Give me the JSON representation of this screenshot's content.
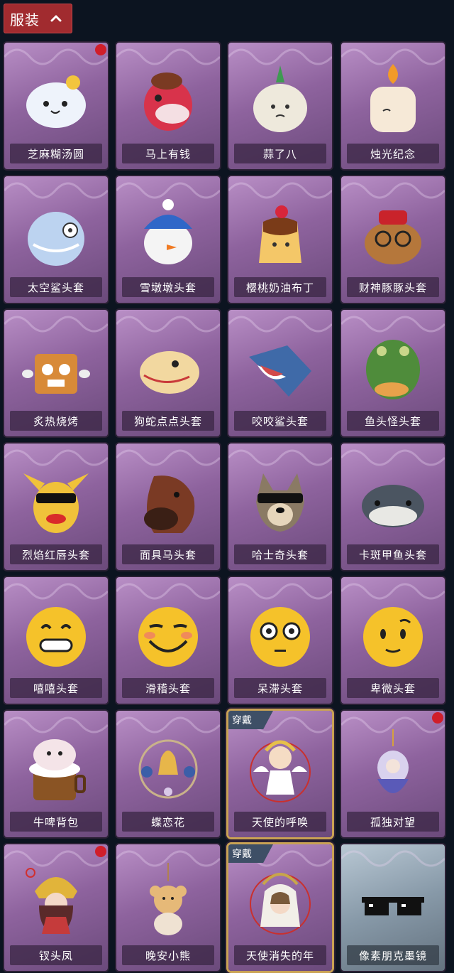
{
  "category": {
    "label": "服装",
    "toggle_icon": "chevron-up-icon"
  },
  "colors": {
    "accent": "#a12b2f",
    "notification": "#d01e2a",
    "worn_border": "#c9a254"
  },
  "items": [
    {
      "name": "芝麻糊汤圆",
      "icon": "dumpling-icon",
      "new": true
    },
    {
      "name": "马上有钱",
      "icon": "horse-head-icon",
      "new": false
    },
    {
      "name": "蒜了八",
      "icon": "garlic-icon",
      "new": false
    },
    {
      "name": "烛光纪念",
      "icon": "candle-icon",
      "new": false
    },
    {
      "name": "太空鲨头套",
      "icon": "shark-icon",
      "new": false
    },
    {
      "name": "雪墩墩头套",
      "icon": "snowman-icon",
      "new": false
    },
    {
      "name": "樱桃奶油布丁",
      "icon": "pudding-icon",
      "new": false
    },
    {
      "name": "财神豚豚头套",
      "icon": "capybara-icon",
      "new": false
    },
    {
      "name": "炙热烧烤",
      "icon": "bbq-icon",
      "new": false
    },
    {
      "name": "狗蛇点点头套",
      "icon": "snake-icon",
      "new": false
    },
    {
      "name": "咬咬鲨头套",
      "icon": "shark-bite-icon",
      "new": false
    },
    {
      "name": "鱼头怪头套",
      "icon": "fish-head-icon",
      "new": false
    },
    {
      "name": "烈焰红唇头套",
      "icon": "pikachu-icon",
      "new": false
    },
    {
      "name": "面具马头套",
      "icon": "horse-mask-icon",
      "new": false
    },
    {
      "name": "哈士奇头套",
      "icon": "husky-icon",
      "new": false
    },
    {
      "name": "卡斑甲鱼头套",
      "icon": "catfish-icon",
      "new": false
    },
    {
      "name": "嘻嘻头套",
      "icon": "grin-emoji-icon",
      "new": false
    },
    {
      "name": "滑稽头套",
      "icon": "smile-emoji-icon",
      "new": false
    },
    {
      "name": "呆滞头套",
      "icon": "stare-emoji-icon",
      "new": false
    },
    {
      "name": "卑微头套",
      "icon": "humble-emoji-icon",
      "new": false
    },
    {
      "name": "牛啤背包",
      "icon": "beer-cow-icon",
      "new": false
    },
    {
      "name": "蝶恋花",
      "icon": "bell-wreath-icon",
      "new": false
    },
    {
      "name": "天使的呼唤",
      "icon": "angel-icon",
      "new": false,
      "worn_label": "穿戴"
    },
    {
      "name": "孤独对望",
      "icon": "doll-charm-icon",
      "new": true
    },
    {
      "name": "钗头凤",
      "icon": "phoenix-crown-icon",
      "new": true
    },
    {
      "name": "晚安小熊",
      "icon": "teddy-bear-icon",
      "new": false
    },
    {
      "name": "天使消失的年",
      "icon": "angel-girl-icon",
      "new": false,
      "worn_label": "穿戴"
    },
    {
      "name": "像素朋克墨镜",
      "icon": "pixel-sunglasses-icon",
      "new": false
    }
  ]
}
